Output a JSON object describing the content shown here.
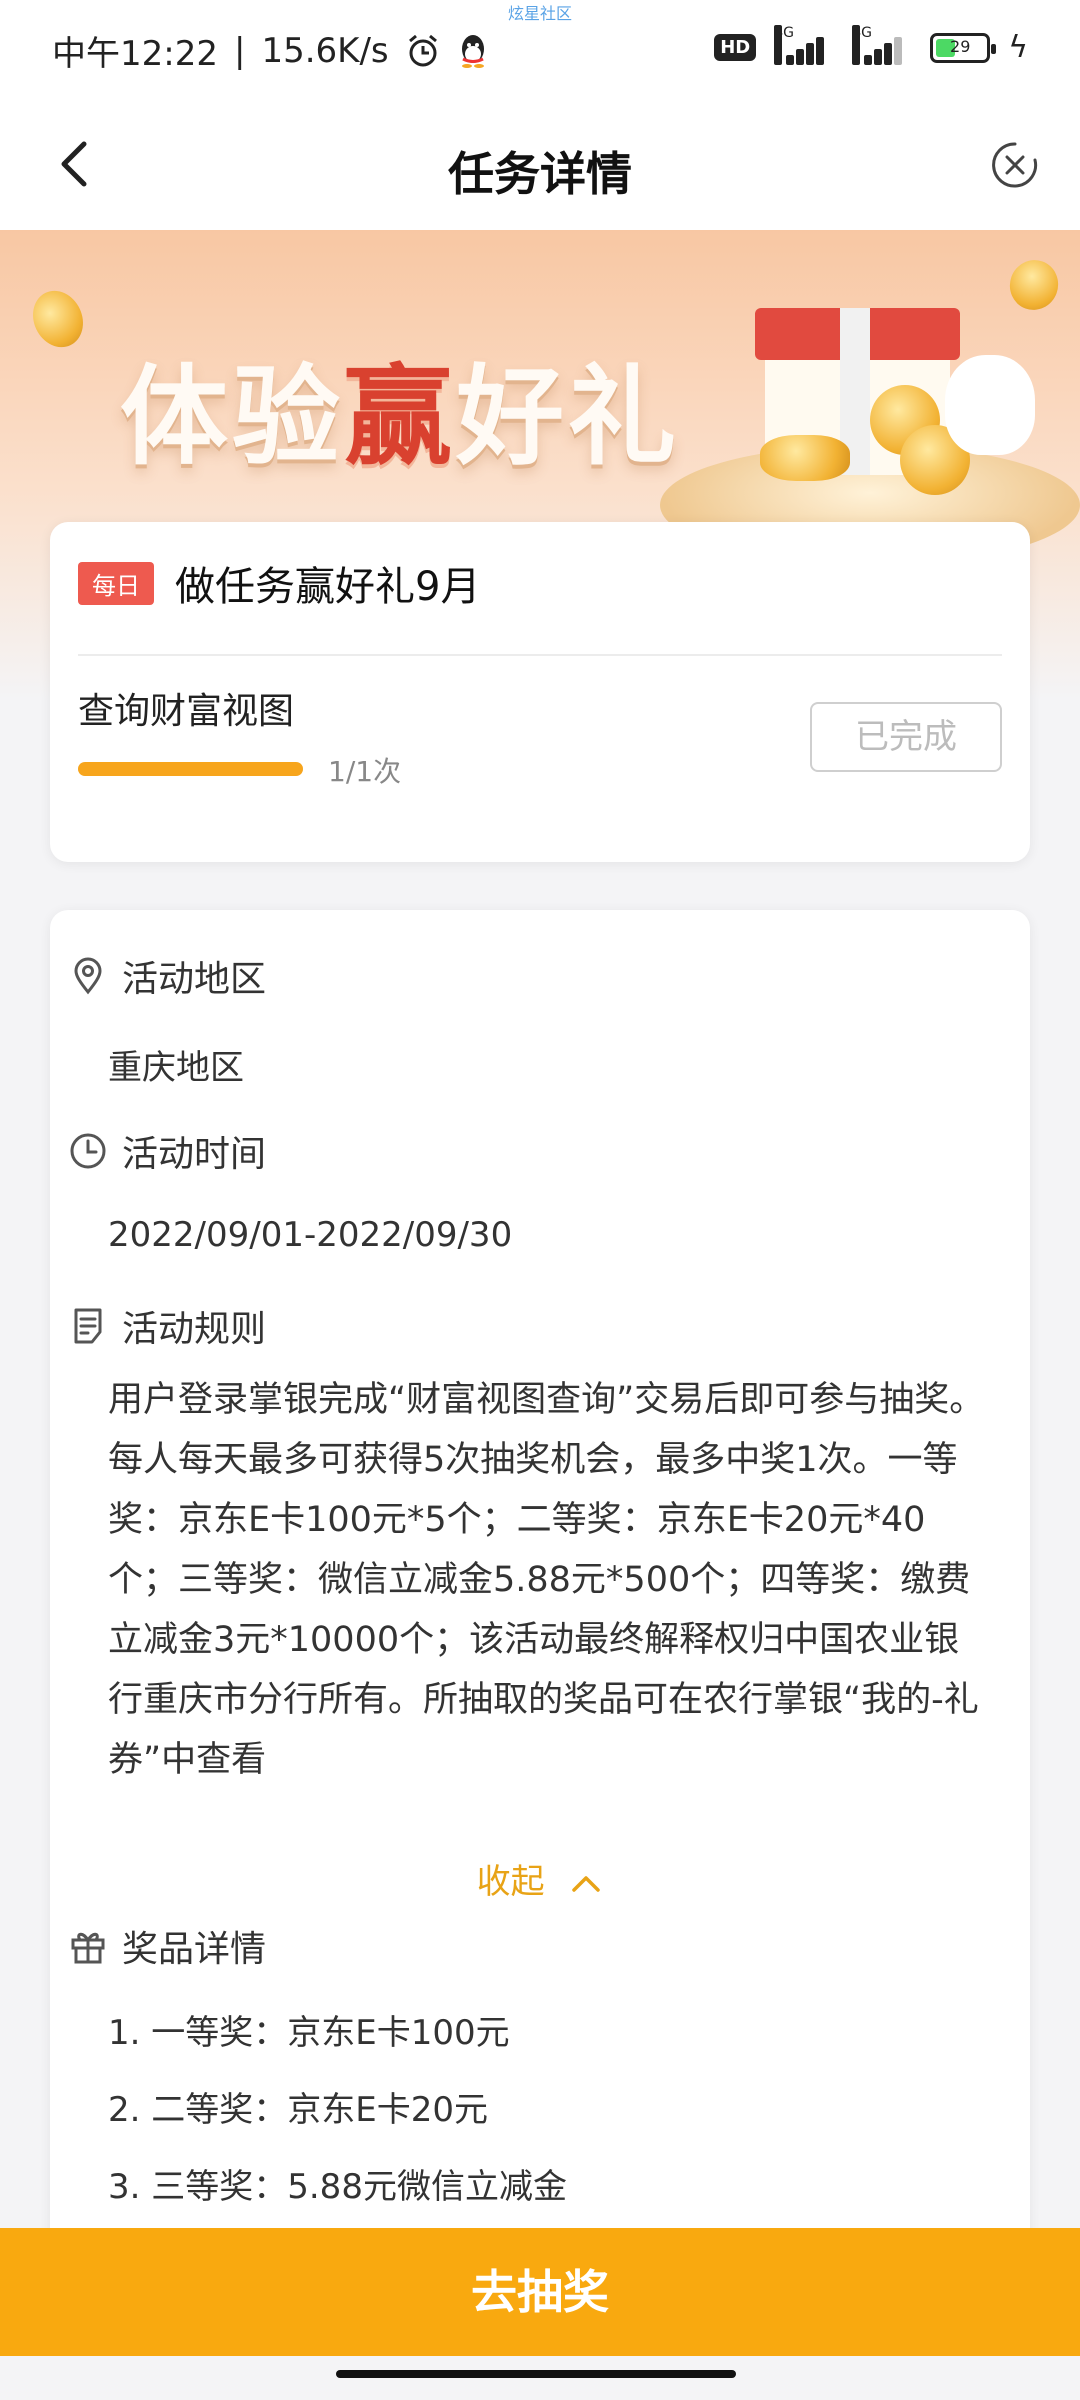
{
  "status_bar": {
    "caption": "炫星社区",
    "time": "中午12:22",
    "speed": "15.6K/s",
    "hd": "HD",
    "net1": "4G",
    "net2": "4G",
    "battery": "29"
  },
  "nav": {
    "title": "任务详情"
  },
  "banner": {
    "title_pre": "体验",
    "title_hl": "赢",
    "title_post": "好礼"
  },
  "task_card": {
    "badge": "每日",
    "title": "做任务赢好礼9月",
    "task_name": "查询财富视图",
    "progress_text": "1/1次",
    "progress_fraction": 1,
    "button_label": "已完成"
  },
  "info": {
    "region_heading": "活动地区",
    "region_value": "重庆地区",
    "time_heading": "活动时间",
    "time_value": "2022/09/01-2022/09/30",
    "rules_heading": "活动规则",
    "rules_text": "用户登录掌银完成“财富视图查询”交易后即可参与抽奖。每人每天最多可获得5次抽奖机会，最多中奖1次。一等奖：京东E卡100元*5个；二等奖：京东E卡20元*40个；三等奖：微信立减金5.88元*500个；四等奖：缴费立减金3元*10000个；该活动最终解释权归中国农业银行重庆市分行所有。所抽取的奖品可在农行掌银“我的-礼券”中查看",
    "collapse_label": "收起",
    "prizes_heading": "奖品详情",
    "prizes": [
      "1. 一等奖：京东E卡100元",
      "2. 二等奖：京东E卡20元",
      "3. 三等奖：5.88元微信立减金"
    ]
  },
  "bottom": {
    "button_label": "去抽奖"
  },
  "colors": {
    "accent": "#f9a90f",
    "badge": "#ee5a4f",
    "link": "#e8a316"
  }
}
